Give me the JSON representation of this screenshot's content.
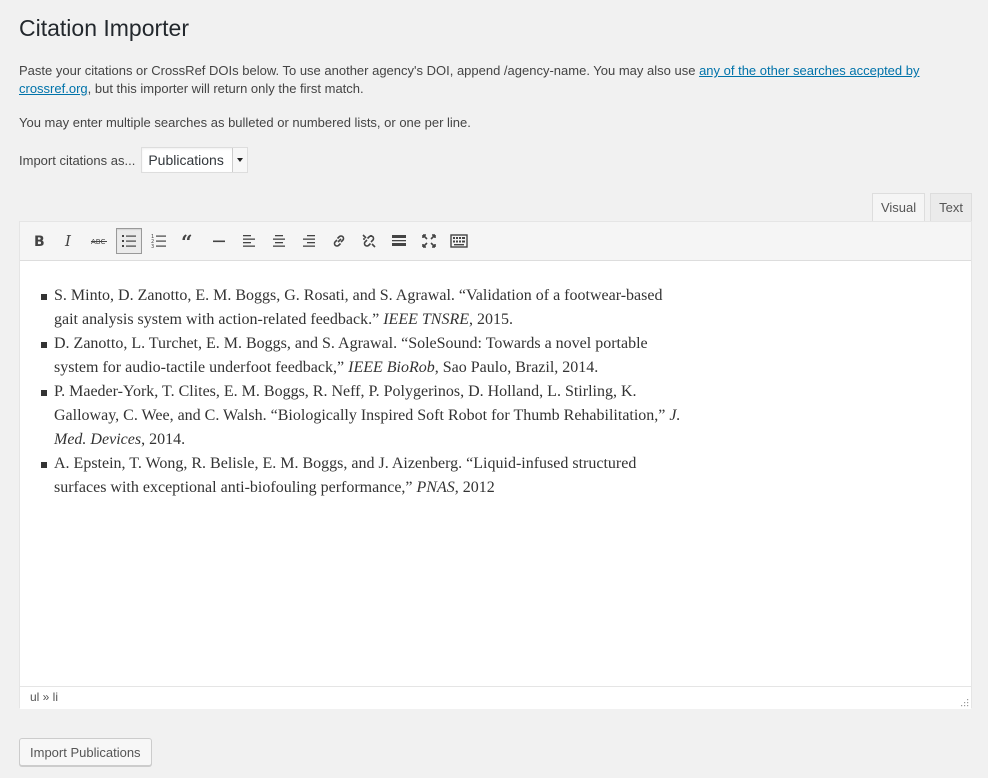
{
  "page": {
    "title": "Citation Importer",
    "intro_text": "Paste your citations or CrossRef DOIs below. To use another agency's DOI, append /agency-name. You may also use ",
    "intro_link": "any of the other searches accepted by crossref.org",
    "intro_tail": ", but this importer will return only the first match.",
    "multi_text": "You may enter multiple searches as bulleted or numbered lists, or one per line.",
    "import_label": "Import citations as...",
    "import_value": "Publications"
  },
  "editor": {
    "tabs": [
      {
        "label": "Visual",
        "active": true
      },
      {
        "label": "Text",
        "active": false
      }
    ],
    "toolbar": [
      {
        "name": "bold-icon"
      },
      {
        "name": "italic-icon"
      },
      {
        "name": "strikethrough-icon"
      },
      {
        "name": "bulleted-list-icon",
        "active": true
      },
      {
        "name": "numbered-list-icon"
      },
      {
        "name": "blockquote-icon"
      },
      {
        "name": "horizontal-line-icon"
      },
      {
        "name": "align-left-icon"
      },
      {
        "name": "align-center-icon"
      },
      {
        "name": "align-right-icon"
      },
      {
        "name": "insert-link-icon"
      },
      {
        "name": "remove-link-icon"
      },
      {
        "name": "read-more-icon"
      },
      {
        "name": "fullscreen-icon"
      },
      {
        "name": "toolbar-toggle-icon"
      }
    ],
    "citations": [
      {
        "plain": "S. Minto, D. Zanotto, E. M. Boggs, G. Rosati, and S. Agrawal. “Validation of a footwear-based gait analysis system with action-related feedback.” ",
        "journal": "IEEE TNSRE",
        "tail": ", 2015."
      },
      {
        "plain": "D. Zanotto, L. Turchet, E. M. Boggs, and S. Agrawal. “SoleSound: Towards a novel portable system for audio-tactile underfoot feedback,” ",
        "journal": "IEEE BioRob",
        "tail": ", Sao Paulo, Brazil, 2014."
      },
      {
        "plain": "P. Maeder-York, T. Clites, E. M. Boggs, R. Neff, P. Polygerinos, D. Holland, L. Stirling, K. Galloway, C. Wee, and C. Walsh. “Biologically Inspired Soft Robot for Thumb Rehabilitation,” ",
        "journal": "J. Med. Devices",
        "tail": ", 2014."
      },
      {
        "plain": "A. Epstein, T. Wong, R. Belisle, E. M. Boggs, and J. Aizenberg. “Liquid-infused structured surfaces with exceptional anti-biofouling performance,” ",
        "journal": "PNAS",
        "tail": ", 2012"
      }
    ],
    "statusbar_path": "ul » li"
  },
  "submit_label": "Import Publications"
}
